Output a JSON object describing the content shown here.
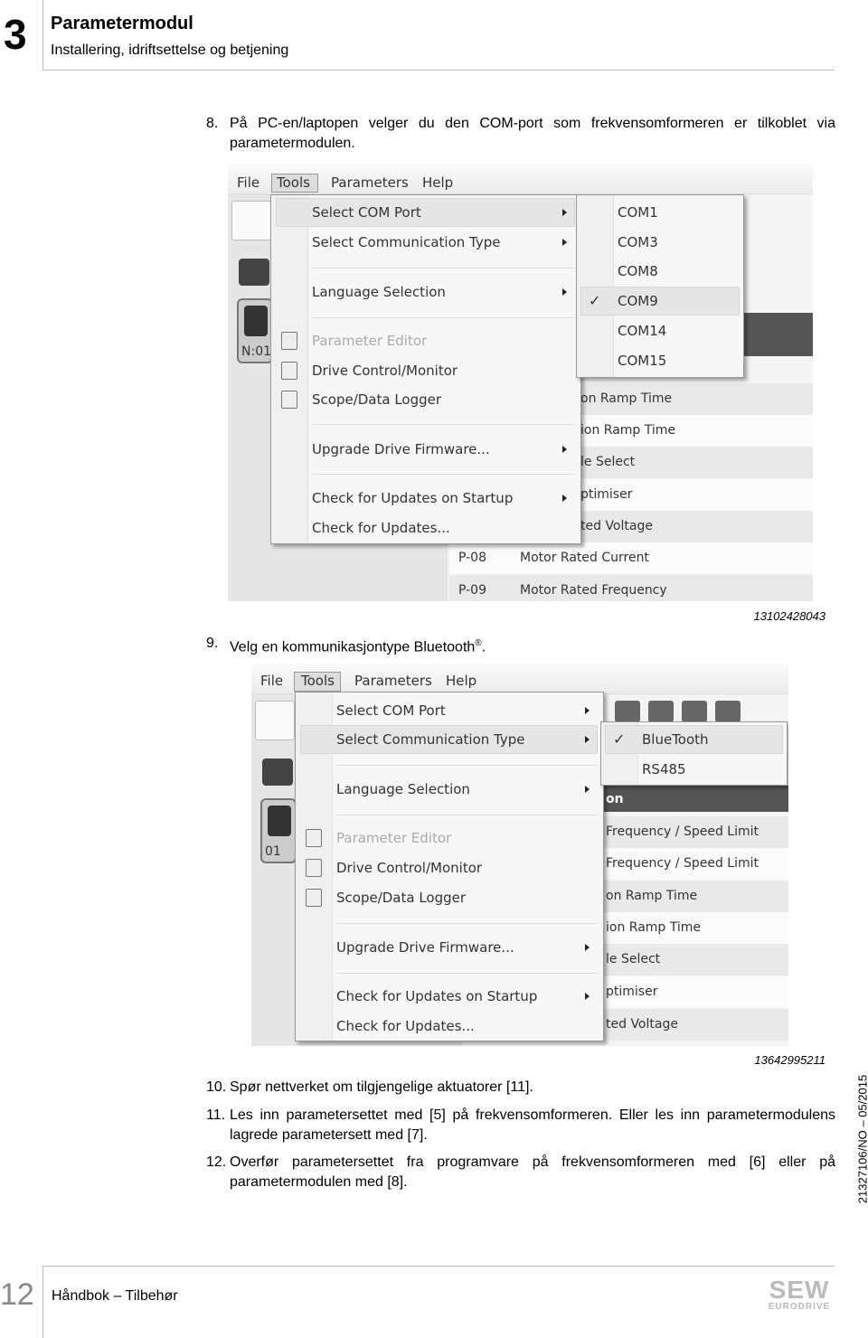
{
  "header": {
    "chapter": "3",
    "title": "Parametermodul",
    "subtitle": "Installering, idriftsettelse og betjening"
  },
  "steps": [
    {
      "num": "8.",
      "text": "På PC-en/laptopen velger du den COM-port som frekvensomformeren er tilkoblet via parametermodulen."
    },
    {
      "num": "9.",
      "text": "Velg en kommunikasjontype Bluetooth",
      "sup": "®",
      "end": "."
    },
    {
      "num": "10.",
      "text": "Spør nettverket om tilgjengelige aktuatorer [11]."
    },
    {
      "num": "11.",
      "text": "Les inn parametersettet med [5] på frekvensomformeren. Eller les inn parametermodulens lagrede parametersett med [7]."
    },
    {
      "num": "12.",
      "text": "Overfør parametersettet fra programvare på frekvensomformeren med [6] eller på parametermodulen med [8]."
    }
  ],
  "figures": [
    {
      "caption": "13102428043",
      "menubar": [
        "File",
        "Tools",
        "Parameters",
        "Help"
      ],
      "active_menu": "Tools",
      "tools_menu": [
        {
          "label": "Select COM Port",
          "submenu": true,
          "highlighted": true
        },
        {
          "label": "Select Communication Type",
          "submenu": true
        },
        {
          "label": "Language Selection",
          "submenu": true
        },
        {
          "label": "Parameter Editor",
          "disabled": true,
          "icon": "list-icon"
        },
        {
          "label": "Drive Control/Monitor",
          "icon": "monitor-icon"
        },
        {
          "label": "Scope/Data Logger",
          "icon": "scope-icon"
        },
        {
          "label": "Upgrade Drive Firmware...",
          "submenu": true
        },
        {
          "label": "Check for Updates on Startup",
          "submenu": true
        },
        {
          "label": "Check for Updates..."
        }
      ],
      "submenu": [
        {
          "label": "COM1"
        },
        {
          "label": "COM3"
        },
        {
          "label": "COM8"
        },
        {
          "label": "COM9",
          "checked": true
        },
        {
          "label": "COM14"
        },
        {
          "label": "COM15"
        }
      ],
      "device_label": "N:01",
      "table_rows": [
        {
          "code": "",
          "name": "on Ramp Time"
        },
        {
          "code": "",
          "name": "ion Ramp Time"
        },
        {
          "code": "",
          "name": "le Select"
        },
        {
          "code": "",
          "name": "ptimiser"
        },
        {
          "code": "",
          "name": "ted Voltage"
        },
        {
          "code": "P-08",
          "name": "Motor Rated Current"
        },
        {
          "code": "P-09",
          "name": "Motor Rated Frequency"
        }
      ]
    },
    {
      "caption": "13642995211",
      "menubar": [
        "File",
        "Tools",
        "Parameters",
        "Help"
      ],
      "active_menu": "Tools",
      "tools_menu": [
        {
          "label": "Select COM Port",
          "submenu": true
        },
        {
          "label": "Select Communication Type",
          "submenu": true,
          "highlighted": true
        },
        {
          "label": "Language Selection",
          "submenu": true
        },
        {
          "label": "Parameter Editor",
          "disabled": true,
          "icon": "list-icon"
        },
        {
          "label": "Drive Control/Monitor",
          "icon": "monitor-icon"
        },
        {
          "label": "Scope/Data Logger",
          "icon": "scope-icon"
        },
        {
          "label": "Upgrade Drive Firmware...",
          "submenu": true
        },
        {
          "label": "Check for Updates on Startup",
          "submenu": true
        },
        {
          "label": "Check for Updates..."
        }
      ],
      "submenu": [
        {
          "label": "BlueTooth",
          "checked": true
        },
        {
          "label": "RS485"
        }
      ],
      "device_label": "01",
      "header_fragment": "on",
      "table_rows": [
        {
          "code": "",
          "name": "Frequency / Speed Limit"
        },
        {
          "code": "",
          "name": "Frequency / Speed Limit"
        },
        {
          "code": "",
          "name": "on Ramp Time"
        },
        {
          "code": "",
          "name": "ion Ramp Time"
        },
        {
          "code": "",
          "name": "le Select"
        },
        {
          "code": "",
          "name": "ptimiser"
        },
        {
          "code": "",
          "name": "ted Voltage"
        }
      ]
    }
  ],
  "sidebar_code": "21327106/NO – 05/2015",
  "footer": {
    "page": "12",
    "title": "Håndbok – Tilbehør",
    "logo": "SEW EURODRIVE"
  }
}
